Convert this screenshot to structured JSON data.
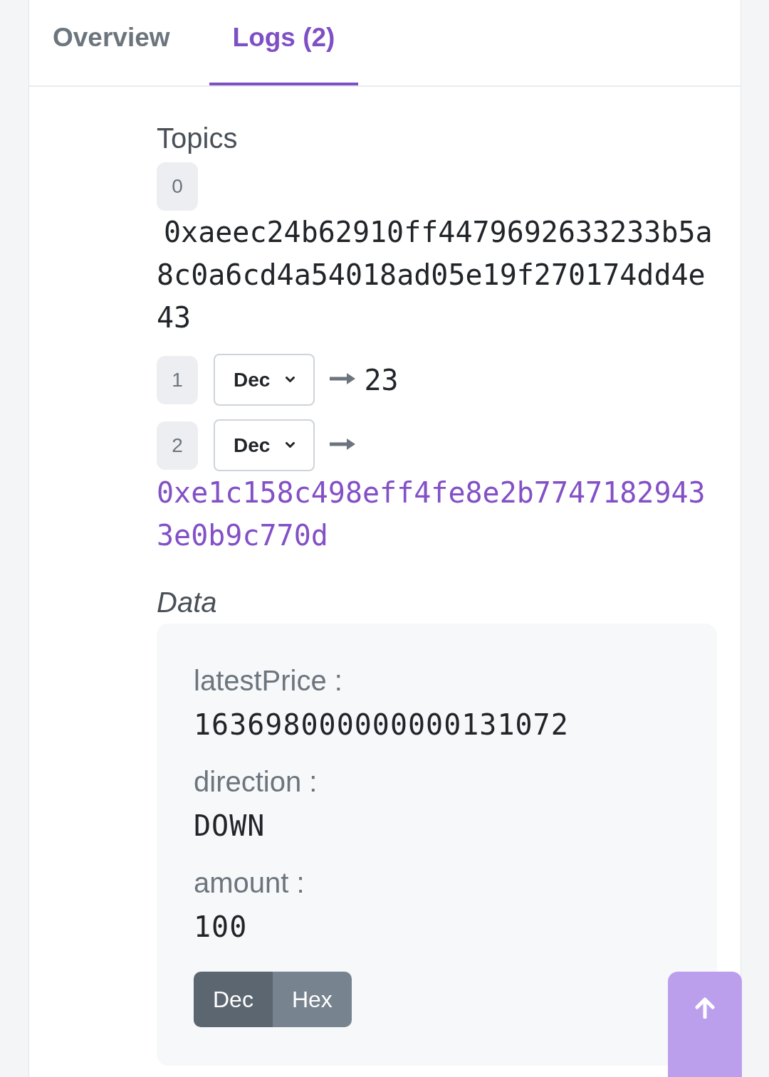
{
  "tabs": [
    {
      "label": "Overview",
      "selected": false
    },
    {
      "label": "Logs (2)",
      "selected": true
    }
  ],
  "topics": {
    "heading": "Topics",
    "items": [
      {
        "index": "0",
        "kind": "raw",
        "value": "0xaeec24b62910ff4479692633233b5a8c0a6cd4a54018ad05e19f270174dd4e43"
      },
      {
        "index": "1",
        "kind": "decoded",
        "format": "Dec",
        "value": "23",
        "link": false
      },
      {
        "index": "2",
        "kind": "decoded",
        "format": "Dec",
        "value": "0xe1c158c498eff4fe8e2b77471829433e0b9c770d",
        "link": true
      }
    ]
  },
  "data": {
    "heading": "Data",
    "fields": [
      {
        "name": "latestPrice :",
        "value": "163698000000000131072"
      },
      {
        "name": "direction :",
        "value": "DOWN"
      },
      {
        "name": "amount :",
        "value": "100"
      }
    ],
    "formats": [
      {
        "label": "Dec",
        "selected": true
      },
      {
        "label": "Hex",
        "selected": false
      }
    ]
  }
}
